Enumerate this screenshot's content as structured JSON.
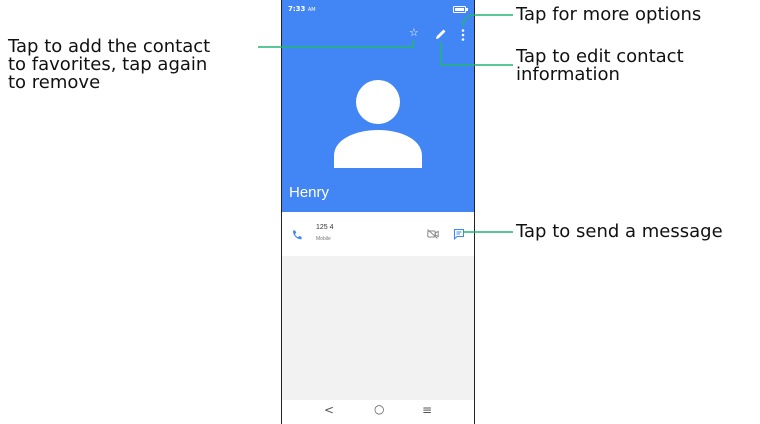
{
  "status_bar": {
    "time": "7:33",
    "ampm": "AM"
  },
  "contact": {
    "name": "Henry",
    "number": "125 4",
    "number_type": "Mobile"
  },
  "navbar": {
    "back": "<",
    "home": "○",
    "recents": "≡"
  },
  "callouts": {
    "favorites": "Tap to add the contact\nto favorites, tap again\nto remove",
    "more_options": "Tap for more options",
    "edit": "Tap to edit contact\ninformation",
    "message": "Tap to send a message"
  },
  "colors": {
    "header_blue": "#4285f4",
    "callout_line": "#22b573",
    "icon_blue": "#4285f4"
  },
  "icons": [
    "star-outline-icon",
    "edit-pencil-icon",
    "more-vert-icon",
    "person-avatar-icon",
    "phone-icon",
    "video-off-icon",
    "message-icon",
    "battery-icon"
  ]
}
